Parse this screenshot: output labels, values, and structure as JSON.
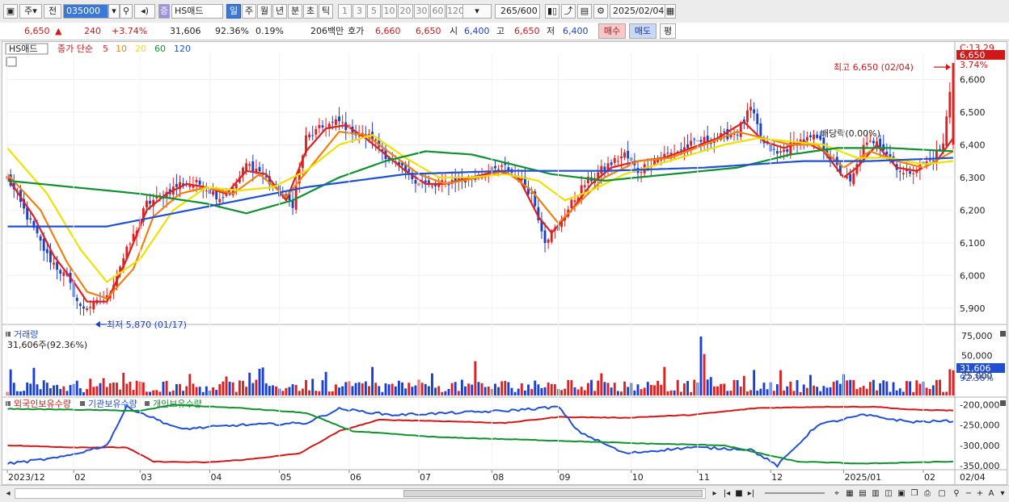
{
  "toolbar": {
    "market": "주",
    "prev": "전",
    "code": "035000",
    "name": "HS애드",
    "stock_badge": "증",
    "periods": [
      "일",
      "주",
      "월",
      "년",
      "분",
      "초",
      "틱"
    ],
    "active_period": "일",
    "intervals": [
      "1",
      "3",
      "5",
      "10",
      "20",
      "30",
      "60",
      "120"
    ],
    "count": "265",
    "count_max": "/600",
    "date": "2025/02/04"
  },
  "quote": {
    "price": "6,650",
    "arrow": "▲",
    "change": "240",
    "change_pct": "+3.74%",
    "volume": "31,606",
    "vol_ratio": "92.36%",
    "turnover": "0.19%",
    "amount": "206백만",
    "hoga_label": "호가",
    "ask": "6,660",
    "bid": "6,650",
    "open_label": "시",
    "open": "6,400",
    "high_label": "고",
    "high": "6,650",
    "low_label": "저",
    "low": "6,400",
    "buy_btn": "매수",
    "sell_btn": "매도",
    "eval_btn": "평"
  },
  "price_panel": {
    "legend_name": "HS애드",
    "legend_ma_label": "종가 단순",
    "ma_periods": [
      "5",
      "10",
      "20",
      "60",
      "120"
    ],
    "ma_colors": [
      "#e02020",
      "#f08010",
      "#f0e000",
      "#109030",
      "#2050d0"
    ],
    "high_marker": "최고 6,650 (02/04)",
    "low_marker": "최저 5,870 (01/17)",
    "dividend_marker": "배당락(0.00%)",
    "right_top_label": "C:13.29",
    "current_price_tag": "6,650",
    "current_pct_tag": "3.74%",
    "y_ticks": [
      "6,600",
      "6,500",
      "6,400",
      "6,300",
      "6,200",
      "6,100",
      "6,000",
      "5,900"
    ]
  },
  "volume_panel": {
    "title": "거래량",
    "value": "31,606주(92.36%)",
    "y_ticks": [
      "75,000",
      "50,000",
      "25,000"
    ],
    "tag_value": "31,606",
    "tag_pct": "92.36%"
  },
  "holdings_panel": {
    "series_labels": [
      "외국인보유수량",
      "기관보유수량",
      "개인보유수량"
    ],
    "series_colors": [
      "#d01818",
      "#2050d0",
      "#109030"
    ],
    "y_ticks": [
      "-200,000",
      "-250,000",
      "-300,000",
      "-350,000"
    ]
  },
  "x_axis": {
    "labels": [
      "2023/12",
      "02",
      "03",
      "04",
      "05",
      "06",
      "07",
      "08",
      "09",
      "10",
      "11",
      "12",
      "2025/01",
      "02"
    ],
    "right_label": "02/04"
  },
  "colors": {
    "up": "#e02020",
    "down": "#1a3fd0",
    "accent": "#3c78d8"
  },
  "chart_data": {
    "type": "candlestick",
    "title": "HS애드",
    "period": "daily",
    "ylim": [
      5850,
      6680
    ],
    "start_label": "2023/12",
    "end_label": "02/04",
    "last_close": 6650,
    "prev_close": 6410,
    "max": {
      "value": 6650,
      "date": "02/04"
    },
    "min": {
      "value": 5870,
      "date": "01/17"
    },
    "close_anchors": [
      [
        0,
        6300
      ],
      [
        6,
        6180
      ],
      [
        12,
        6060
      ],
      [
        18,
        5990
      ],
      [
        22,
        5900
      ],
      [
        26,
        5910
      ],
      [
        30,
        5930
      ],
      [
        34,
        6030
      ],
      [
        38,
        6120
      ],
      [
        42,
        6220
      ],
      [
        46,
        6240
      ],
      [
        52,
        6280
      ],
      [
        58,
        6280
      ],
      [
        64,
        6240
      ],
      [
        68,
        6260
      ],
      [
        72,
        6340
      ],
      [
        76,
        6320
      ],
      [
        82,
        6250
      ],
      [
        86,
        6220
      ],
      [
        90,
        6420
      ],
      [
        96,
        6460
      ],
      [
        100,
        6470
      ],
      [
        106,
        6430
      ],
      [
        110,
        6420
      ],
      [
        114,
        6370
      ],
      [
        118,
        6330
      ],
      [
        122,
        6300
      ],
      [
        128,
        6270
      ],
      [
        134,
        6290
      ],
      [
        140,
        6300
      ],
      [
        146,
        6320
      ],
      [
        150,
        6330
      ],
      [
        154,
        6300
      ],
      [
        158,
        6250
      ],
      [
        162,
        6110
      ],
      [
        166,
        6150
      ],
      [
        170,
        6220
      ],
      [
        174,
        6280
      ],
      [
        180,
        6330
      ],
      [
        186,
        6370
      ],
      [
        190,
        6320
      ],
      [
        196,
        6360
      ],
      [
        202,
        6380
      ],
      [
        208,
        6410
      ],
      [
        214,
        6420
      ],
      [
        220,
        6440
      ],
      [
        224,
        6510
      ],
      [
        228,
        6400
      ],
      [
        232,
        6370
      ],
      [
        238,
        6410
      ],
      [
        244,
        6420
      ],
      [
        250,
        6330
      ],
      [
        254,
        6280
      ],
      [
        258,
        6390
      ],
      [
        262,
        6420
      ],
      [
        266,
        6360
      ],
      [
        270,
        6310
      ],
      [
        274,
        6330
      ],
      [
        278,
        6350
      ],
      [
        282,
        6400
      ],
      [
        285,
        6650
      ]
    ],
    "ma_series": [
      {
        "name": "5",
        "anchors": [
          [
            0,
            6300
          ],
          [
            8,
            6180
          ],
          [
            14,
            6060
          ],
          [
            20,
            5980
          ],
          [
            24,
            5920
          ],
          [
            30,
            5920
          ],
          [
            36,
            6050
          ],
          [
            42,
            6200
          ],
          [
            48,
            6250
          ],
          [
            54,
            6280
          ],
          [
            60,
            6270
          ],
          [
            66,
            6250
          ],
          [
            72,
            6320
          ],
          [
            78,
            6310
          ],
          [
            84,
            6230
          ],
          [
            90,
            6380
          ],
          [
            96,
            6450
          ],
          [
            102,
            6460
          ],
          [
            108,
            6420
          ],
          [
            114,
            6370
          ],
          [
            120,
            6320
          ],
          [
            126,
            6280
          ],
          [
            132,
            6280
          ],
          [
            140,
            6300
          ],
          [
            148,
            6320
          ],
          [
            154,
            6300
          ],
          [
            160,
            6180
          ],
          [
            164,
            6130
          ],
          [
            170,
            6200
          ],
          [
            176,
            6280
          ],
          [
            182,
            6330
          ],
          [
            190,
            6350
          ],
          [
            198,
            6360
          ],
          [
            206,
            6390
          ],
          [
            214,
            6420
          ],
          [
            222,
            6470
          ],
          [
            228,
            6410
          ],
          [
            234,
            6390
          ],
          [
            240,
            6410
          ],
          [
            246,
            6380
          ],
          [
            252,
            6300
          ],
          [
            256,
            6330
          ],
          [
            262,
            6400
          ],
          [
            268,
            6330
          ],
          [
            274,
            6320
          ],
          [
            280,
            6350
          ],
          [
            285,
            6420
          ]
        ]
      },
      {
        "name": "10",
        "anchors": [
          [
            0,
            6310
          ],
          [
            10,
            6200
          ],
          [
            18,
            6040
          ],
          [
            24,
            5950
          ],
          [
            30,
            5930
          ],
          [
            38,
            6020
          ],
          [
            44,
            6180
          ],
          [
            52,
            6250
          ],
          [
            60,
            6270
          ],
          [
            68,
            6250
          ],
          [
            76,
            6310
          ],
          [
            84,
            6240
          ],
          [
            92,
            6340
          ],
          [
            100,
            6440
          ],
          [
            108,
            6430
          ],
          [
            116,
            6370
          ],
          [
            124,
            6310
          ],
          [
            132,
            6280
          ],
          [
            142,
            6300
          ],
          [
            150,
            6320
          ],
          [
            158,
            6260
          ],
          [
            166,
            6160
          ],
          [
            172,
            6220
          ],
          [
            180,
            6300
          ],
          [
            190,
            6350
          ],
          [
            200,
            6360
          ],
          [
            210,
            6400
          ],
          [
            220,
            6440
          ],
          [
            228,
            6420
          ],
          [
            236,
            6400
          ],
          [
            244,
            6400
          ],
          [
            252,
            6330
          ],
          [
            260,
            6380
          ],
          [
            268,
            6350
          ],
          [
            276,
            6330
          ],
          [
            285,
            6380
          ]
        ]
      },
      {
        "name": "20",
        "anchors": [
          [
            0,
            6390
          ],
          [
            12,
            6250
          ],
          [
            22,
            6080
          ],
          [
            30,
            5980
          ],
          [
            40,
            6050
          ],
          [
            50,
            6200
          ],
          [
            60,
            6270
          ],
          [
            70,
            6260
          ],
          [
            80,
            6270
          ],
          [
            90,
            6320
          ],
          [
            100,
            6400
          ],
          [
            110,
            6430
          ],
          [
            120,
            6360
          ],
          [
            130,
            6300
          ],
          [
            140,
            6300
          ],
          [
            150,
            6310
          ],
          [
            160,
            6290
          ],
          [
            168,
            6230
          ],
          [
            176,
            6260
          ],
          [
            186,
            6310
          ],
          [
            196,
            6340
          ],
          [
            206,
            6370
          ],
          [
            216,
            6400
          ],
          [
            226,
            6420
          ],
          [
            236,
            6410
          ],
          [
            246,
            6400
          ],
          [
            256,
            6360
          ],
          [
            266,
            6360
          ],
          [
            276,
            6340
          ],
          [
            285,
            6350
          ]
        ]
      },
      {
        "name": "60",
        "anchors": [
          [
            0,
            6290
          ],
          [
            20,
            6270
          ],
          [
            40,
            6250
          ],
          [
            60,
            6220
          ],
          [
            72,
            6190
          ],
          [
            86,
            6230
          ],
          [
            100,
            6300
          ],
          [
            114,
            6350
          ],
          [
            126,
            6380
          ],
          [
            140,
            6370
          ],
          [
            152,
            6340
          ],
          [
            164,
            6310
          ],
          [
            180,
            6290
          ],
          [
            200,
            6310
          ],
          [
            220,
            6330
          ],
          [
            236,
            6370
          ],
          [
            250,
            6390
          ],
          [
            266,
            6390
          ],
          [
            285,
            6380
          ]
        ]
      },
      {
        "name": "120",
        "anchors": [
          [
            0,
            6150
          ],
          [
            30,
            6150
          ],
          [
            60,
            6210
          ],
          [
            90,
            6270
          ],
          [
            120,
            6310
          ],
          [
            150,
            6320
          ],
          [
            180,
            6320
          ],
          [
            210,
            6330
          ],
          [
            240,
            6350
          ],
          [
            260,
            6350
          ],
          [
            285,
            6360
          ]
        ]
      }
    ],
    "volume_max": 75000,
    "volume_last": 31606,
    "holdings": {
      "ylim": [
        -360000,
        -185000
      ],
      "series": [
        {
          "name": "외국인보유수량",
          "anchors": [
            [
              0,
              -300000
            ],
            [
              20,
              -305000
            ],
            [
              36,
              -305000
            ],
            [
              44,
              -340000
            ],
            [
              60,
              -342000
            ],
            [
              72,
              -335000
            ],
            [
              88,
              -320000
            ],
            [
              100,
              -265000
            ],
            [
              112,
              -237000
            ],
            [
              130,
              -240000
            ],
            [
              150,
              -245000
            ],
            [
              166,
              -230000
            ],
            [
              186,
              -232000
            ],
            [
              206,
              -225000
            ],
            [
              226,
              -208000
            ],
            [
              246,
              -205000
            ],
            [
              262,
              -205000
            ],
            [
              272,
              -212000
            ],
            [
              285,
              -214000
            ]
          ]
        },
        {
          "name": "기관보유수량",
          "anchors": [
            [
              0,
              -345000
            ],
            [
              16,
              -330000
            ],
            [
              30,
              -300000
            ],
            [
              36,
              -205000
            ],
            [
              52,
              -260000
            ],
            [
              70,
              -250000
            ],
            [
              90,
              -245000
            ],
            [
              100,
              -210000
            ],
            [
              116,
              -225000
            ],
            [
              134,
              -220000
            ],
            [
              150,
              -215000
            ],
            [
              166,
              -205000
            ],
            [
              172,
              -265000
            ],
            [
              186,
              -320000
            ],
            [
              206,
              -305000
            ],
            [
              224,
              -310000
            ],
            [
              232,
              -350000
            ],
            [
              244,
              -250000
            ],
            [
              258,
              -225000
            ],
            [
              272,
              -242000
            ],
            [
              285,
              -240000
            ]
          ]
        },
        {
          "name": "개인보유수량",
          "anchors": [
            [
              0,
              -210000
            ],
            [
              20,
              -212000
            ],
            [
              40,
              -215000
            ],
            [
              50,
              -200000
            ],
            [
              70,
              -208000
            ],
            [
              90,
              -220000
            ],
            [
              104,
              -265000
            ],
            [
              130,
              -280000
            ],
            [
              160,
              -287000
            ],
            [
              190,
              -295000
            ],
            [
              216,
              -300000
            ],
            [
              238,
              -340000
            ],
            [
              258,
              -345000
            ],
            [
              272,
              -342000
            ],
            [
              285,
              -340000
            ]
          ]
        }
      ]
    }
  }
}
